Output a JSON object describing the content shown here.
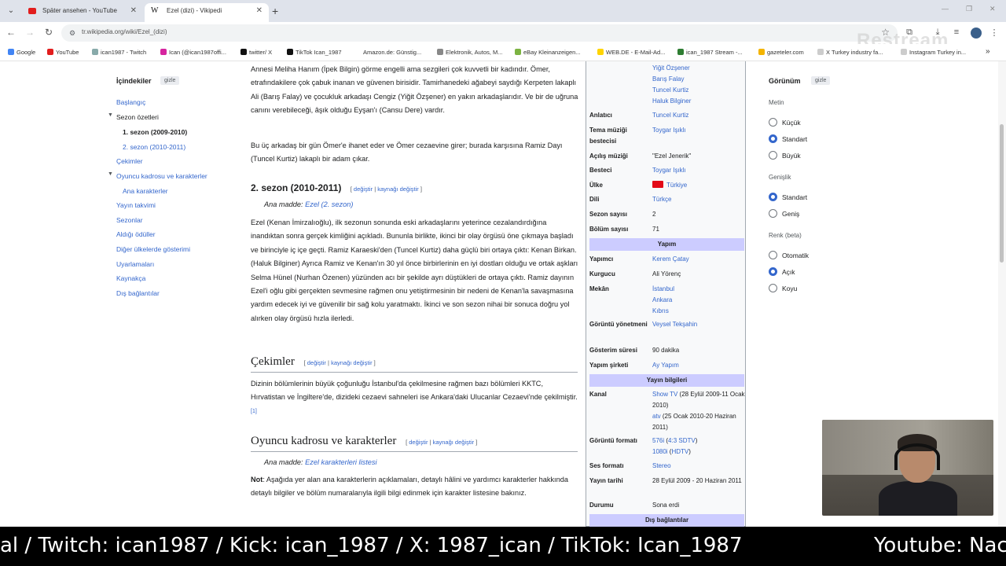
{
  "browser": {
    "tabs": [
      {
        "title": "Später ansehen - YouTube"
      },
      {
        "title": "Ezel (dizi) - Vikipedi"
      }
    ],
    "url": "tr.wikipedia.org/wiki/Ezel_(dizi)",
    "bookmarks": [
      "Google",
      "YouTube",
      "ican1987 - Twitch",
      "Ican (@ican1987offi...",
      "twitter/ X",
      "TikTok Ican_1987",
      "Amazon.de: Günstig...",
      "Elektronik, Autos, M...",
      "eBay Kleinanzeigen...",
      "WEB.DE - E-Mail-Ad...",
      "ican_1987 Stream -...",
      "gazeteler.com",
      "X Turkey industry fa...",
      "Instagram Turkey in..."
    ],
    "watermark": "Restream"
  },
  "toc": {
    "title": "İçindekiler",
    "hide": "gizle",
    "items": [
      "Başlangıç",
      "Sezon özetleri",
      "1. sezon (2009-2010)",
      "2. sezon (2010-2011)",
      "Çekimler",
      "Oyuncu kadrosu ve karakterler",
      "Ana karakterler",
      "Yayın takvimi",
      "Sezonlar",
      "Aldığı ödüller",
      "Diğer ülkelerde gösterimi",
      "Uyarlamaları",
      "Kaynakça",
      "Dış bağlantılar"
    ]
  },
  "article": {
    "p1": "Annesi Meliha Hanım (İpek Bilgin) görme engelli ama sezgileri çok kuvvetli bir kadındır. Ömer, etrafındakilere çok çabuk inanan ve güvenen birisidir. Tamirhanedeki ağabeyi saydığı Kerpeten lakaplı Ali (Barış Falay) ve çocukluk arkadaşı Cengiz (Yiğit Özşener) en yakın arkadaşlarıdır. Ve bir de uğruna canını verebileceği, âşık olduğu Eyşan'ı (Cansu Dere) vardır.",
    "p2": "Bu üç arkadaş bir gün Ömer'e ihanet eder ve Ömer cezaevine girer; burada karşısına Ramiz Dayı (Tuncel Kurtiz) lakaplı bir adam çıkar.",
    "h_season2": "2. sezon (2010-2011)",
    "edit": "değiştir",
    "edit_source": "kaynağı değiştir",
    "main_label": "Ana madde:",
    "main_season2": "Ezel (2. sezon)",
    "p3": "Ezel (Kenan İmirzalıoğlu), ilk sezonun sonunda eski arkadaşlarını yeterince cezalandırdığına inandıktan sonra gerçek kimliğini açıkladı. Bununla birlikte, ikinci bir olay örgüsü öne çıkmaya başladı ve birinciyle iç içe geçti. Ramiz Karaeski'den (Tuncel Kurtiz) daha güçlü biri ortaya çıktı: Kenan Birkan. (Haluk Bilginer) Ayrıca Ramiz ve Kenan'ın 30 yıl önce birbirlerinin en iyi dostları olduğu ve ortak aşkları Selma Hünel (Nurhan Özenen) yüzünden acı bir şekilde ayrı düştükleri de ortaya çıktı. Ramiz dayının Ezel'i oğlu gibi gerçekten sevmesine rağmen onu yetiştirmesinin bir nedeni de Kenan'la savaşmasına yardım edecek iyi ve güvenilir bir sağ kolu yaratmaktı. İkinci ve son sezon nihai bir sonuca doğru yol alırken olay örgüsü hızla ilerledi.",
    "h_cekimler": "Çekimler",
    "p4": "Dizinin bölümlerinin büyük çoğunluğu İstanbul'da çekilmesine rağmen bazı bölümleri KKTC, Hırvatistan ve İngiltere'de, dizideki cezaevi sahneleri ise Ankara'daki Ulucanlar Cezaevi'nde çekilmiştir.",
    "ref": "[1]",
    "h_cast": "Oyuncu kadrosu ve karakterler",
    "main_cast": "Ezel karakterleri listesi",
    "note_label": "Not",
    "note": ": Aşağıda yer alan ana karakterlerin açıklamaları, detaylı hâlini ve yardımcı karakterler hakkında detaylı bilgiler ve bölüm numaralarıyla ilgili bilgi edinmek için karakter listesine bakınız."
  },
  "infobox": {
    "cast_tail": [
      "Yiğit Özşener",
      "Barış Falay",
      "Tuncel Kurtiz",
      "Haluk Bilginer"
    ],
    "rows": [
      {
        "label": "Anlatıcı",
        "value": "Tuncel Kurtiz"
      },
      {
        "label": "Tema müziği bestecisi",
        "value": "Toygar Işıklı"
      },
      {
        "label": "Açılış müziği",
        "value": "\"Ezel Jenerik\""
      },
      {
        "label": "Besteci",
        "value": "Toygar Işıklı"
      },
      {
        "label": "Ülke",
        "value": "Türkiye"
      },
      {
        "label": "Dili",
        "value": "Türkçe"
      },
      {
        "label": "Sezon sayısı",
        "value": "2"
      },
      {
        "label": "Bölüm sayısı",
        "value": "71"
      }
    ],
    "band_yapim": "Yapım",
    "rows2": [
      {
        "label": "Yapımcı",
        "value": "Kerem Çatay"
      },
      {
        "label": "Kurgucu",
        "value": "Ali Yörenç"
      },
      {
        "label": "Mekân",
        "value": "İstanbul"
      },
      {
        "label": "Mekân2",
        "value": "Ankara"
      },
      {
        "label": "Mekân3",
        "value": "Kıbrıs"
      },
      {
        "label": "Görüntü yönetmeni",
        "value": "Veysel Tekşahin"
      },
      {
        "label": "Gösterim süresi",
        "value": "90 dakika"
      },
      {
        "label": "Yapım şirketi",
        "value": "Ay Yapım"
      }
    ],
    "band_yayin": "Yayın bilgileri",
    "kanal_label": "Kanal",
    "kanal1": "Show TV",
    "kanal1_date": " (28 Eylül 2009-11 Ocak 2010)",
    "kanal2": "atv",
    "kanal2_date": " (25 Ocak 2010-20 Haziran 2011)",
    "format_label": "Görüntü formatı",
    "format1": "576i",
    "format1b": "4:3 SDTV",
    "format2": "1080i",
    "format2b": "HDTV",
    "ses_label": "Ses formatı",
    "ses": "Stereo",
    "tarih_label": "Yayın tarihi",
    "tarih": "28 Eylül 2009 - 20 Haziran 2011",
    "durum_label": "Durumu",
    "durum": "Sona erdi",
    "band_dis": "Dış bağlantılar"
  },
  "appearance": {
    "title": "Görünüm",
    "hide": "gizle",
    "metin": "Metin",
    "metin_opts": [
      "Küçük",
      "Standart",
      "Büyük"
    ],
    "genislik": "Genişlik",
    "genislik_opts": [
      "Standart",
      "Geniş"
    ],
    "renk": "Renk (beta)",
    "renk_opts": [
      "Otomatik",
      "Açık",
      "Koyu"
    ]
  },
  "ticker": {
    "left": "al  / Twitch: ican1987 / Kick: ican_1987 / X: 1987_ican / TikTok: Ican_1987",
    "right": "Youtube: Nac"
  }
}
